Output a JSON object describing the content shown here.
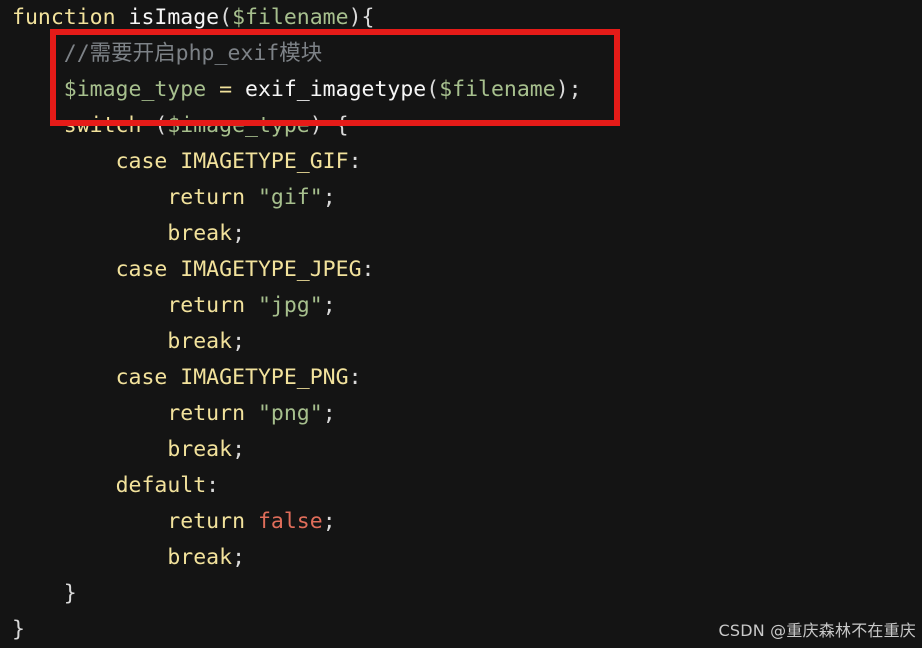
{
  "code": {
    "lines": [
      [
        {
          "t": "function",
          "c": "kw"
        },
        {
          "t": " ",
          "c": "punc"
        },
        {
          "t": "isImage",
          "c": "fn"
        },
        {
          "t": "(",
          "c": "punc"
        },
        {
          "t": "$filename",
          "c": "var"
        },
        {
          "t": "){",
          "c": "punc"
        }
      ],
      [
        {
          "t": "    ",
          "c": "punc"
        },
        {
          "t": "//需要开启php_exif模块",
          "c": "cmt"
        }
      ],
      [
        {
          "t": "    ",
          "c": "punc"
        },
        {
          "t": "$image_type",
          "c": "var"
        },
        {
          "t": " = ",
          "c": "kw"
        },
        {
          "t": "exif_imagetype",
          "c": "fn"
        },
        {
          "t": "(",
          "c": "punc"
        },
        {
          "t": "$filename",
          "c": "var"
        },
        {
          "t": ");",
          "c": "punc"
        }
      ],
      [
        {
          "t": "    ",
          "c": "punc"
        },
        {
          "t": "switch",
          "c": "kw"
        },
        {
          "t": " (",
          "c": "punc"
        },
        {
          "t": "$image_type",
          "c": "var"
        },
        {
          "t": ") {",
          "c": "punc"
        }
      ],
      [
        {
          "t": "        ",
          "c": "punc"
        },
        {
          "t": "case",
          "c": "kw"
        },
        {
          "t": " ",
          "c": "punc"
        },
        {
          "t": "IMAGETYPE_GIF",
          "c": "const"
        },
        {
          "t": ":",
          "c": "punc"
        }
      ],
      [
        {
          "t": "            ",
          "c": "punc"
        },
        {
          "t": "return",
          "c": "kw"
        },
        {
          "t": " ",
          "c": "punc"
        },
        {
          "t": "\"gif\"",
          "c": "str"
        },
        {
          "t": ";",
          "c": "punc"
        }
      ],
      [
        {
          "t": "            ",
          "c": "punc"
        },
        {
          "t": "break",
          "c": "kw"
        },
        {
          "t": ";",
          "c": "punc"
        }
      ],
      [
        {
          "t": "        ",
          "c": "punc"
        },
        {
          "t": "case",
          "c": "kw"
        },
        {
          "t": " ",
          "c": "punc"
        },
        {
          "t": "IMAGETYPE_JPEG",
          "c": "const"
        },
        {
          "t": ":",
          "c": "punc"
        }
      ],
      [
        {
          "t": "            ",
          "c": "punc"
        },
        {
          "t": "return",
          "c": "kw"
        },
        {
          "t": " ",
          "c": "punc"
        },
        {
          "t": "\"jpg\"",
          "c": "str"
        },
        {
          "t": ";",
          "c": "punc"
        }
      ],
      [
        {
          "t": "            ",
          "c": "punc"
        },
        {
          "t": "break",
          "c": "kw"
        },
        {
          "t": ";",
          "c": "punc"
        }
      ],
      [
        {
          "t": "        ",
          "c": "punc"
        },
        {
          "t": "case",
          "c": "kw"
        },
        {
          "t": " ",
          "c": "punc"
        },
        {
          "t": "IMAGETYPE_PNG",
          "c": "const"
        },
        {
          "t": ":",
          "c": "punc"
        }
      ],
      [
        {
          "t": "            ",
          "c": "punc"
        },
        {
          "t": "return",
          "c": "kw"
        },
        {
          "t": " ",
          "c": "punc"
        },
        {
          "t": "\"png\"",
          "c": "str"
        },
        {
          "t": ";",
          "c": "punc"
        }
      ],
      [
        {
          "t": "            ",
          "c": "punc"
        },
        {
          "t": "break",
          "c": "kw"
        },
        {
          "t": ";",
          "c": "punc"
        }
      ],
      [
        {
          "t": "        ",
          "c": "punc"
        },
        {
          "t": "default",
          "c": "kw"
        },
        {
          "t": ":",
          "c": "punc"
        }
      ],
      [
        {
          "t": "            ",
          "c": "punc"
        },
        {
          "t": "return",
          "c": "kw"
        },
        {
          "t": " ",
          "c": "punc"
        },
        {
          "t": "false",
          "c": "bool"
        },
        {
          "t": ";",
          "c": "punc"
        }
      ],
      [
        {
          "t": "            ",
          "c": "punc"
        },
        {
          "t": "break",
          "c": "kw"
        },
        {
          "t": ";",
          "c": "punc"
        }
      ],
      [
        {
          "t": "    ",
          "c": "punc"
        },
        {
          "t": "}",
          "c": "punc"
        }
      ],
      [
        {
          "t": "}",
          "c": "punc"
        }
      ]
    ]
  },
  "highlight": {
    "color": "#e51b18",
    "covers_lines": [
      2,
      3
    ]
  },
  "colors": {
    "background": "#141414",
    "keyword": "#f2e29c",
    "function": "#f6f6f6",
    "variable": "#a7c08e",
    "string": "#a7c08e",
    "comment": "#7d8287",
    "boolean": "#e06d5a"
  },
  "watermark": {
    "text": "CSDN @重庆森林不在重庆"
  }
}
